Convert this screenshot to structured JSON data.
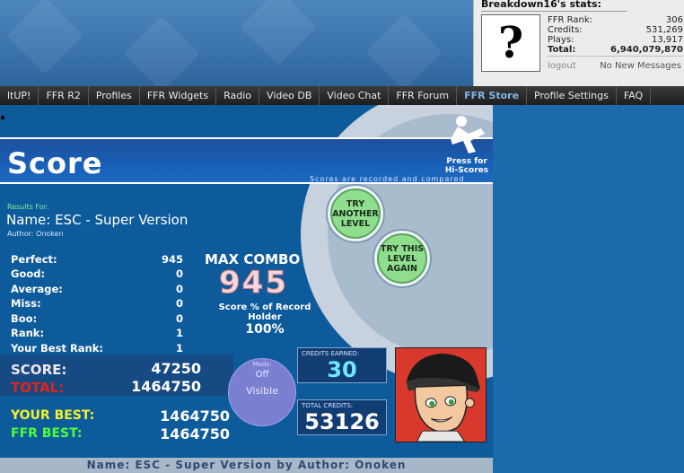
{
  "stats": {
    "title": "Breakdown16's stats:",
    "rows": [
      {
        "label": "FFR Rank:",
        "value": "306"
      },
      {
        "label": "Credits:",
        "value": "531,269"
      },
      {
        "label": "Plays:",
        "value": "13,917"
      },
      {
        "label": "Total:",
        "value": "6,940,079,870"
      }
    ],
    "logout": "logout",
    "messages": "No New Messages"
  },
  "nav": {
    "items": [
      "ltUP!",
      "FFR R2",
      "Profiles",
      "FFR Widgets",
      "Radio",
      "Video DB",
      "Video Chat",
      "FFR Forum",
      "FFR Store",
      "Profile Settings",
      "FAQ"
    ],
    "active": "FFR Store"
  },
  "game": {
    "title": "Score",
    "hiscore_text": "Press for Hi-Scores",
    "recorded_text": "Scores are recorded and compared",
    "try_another": "TRY ANOTHER LEVEL",
    "try_again": "TRY THIS LEVEL AGAIN",
    "results_for": "Results For:",
    "name": "Name: ESC - Super Version",
    "author": "Author: Onoken",
    "judgements": [
      {
        "label": "Perfect:",
        "value": "945"
      },
      {
        "label": "Good:",
        "value": "0"
      },
      {
        "label": "Average:",
        "value": "0"
      },
      {
        "label": "Miss:",
        "value": "0"
      },
      {
        "label": "Boo:",
        "value": "0"
      },
      {
        "label": "Rank:",
        "value": "1"
      },
      {
        "label": "Your Best Rank:",
        "value": "1"
      }
    ],
    "max_combo_label": "MAX COMBO",
    "max_combo_value": "945",
    "record_label": "Score % of Record Holder",
    "record_value": "100%",
    "score_label": "SCORE:",
    "score_value": "47250",
    "total_label": "TOTAL:",
    "total_value": "1464750",
    "mods_label": "Mods:",
    "mods_off": "Off",
    "mods_visible": "Visible",
    "credits_earned_label": "CREDITS EARNED:",
    "credits_earned_value": "30",
    "total_credits_label": "TOTAL CREDITS:",
    "total_credits_value": "53126",
    "your_best_label": "YOUR BEST:",
    "your_best_value": "1464750",
    "ffr_best_label": "FFR BEST:",
    "ffr_best_value": "1464750",
    "footer": "Name: ESC - Super Version by Author: Onoken"
  },
  "colors": {
    "accent_green": "#8fdd8f",
    "score_label": "#f1e7ef",
    "total_label": "#e2231a",
    "your_best": "#f2f22a",
    "ffr_best": "#4aff3a",
    "credits_cyan": "#6fe8ff"
  }
}
